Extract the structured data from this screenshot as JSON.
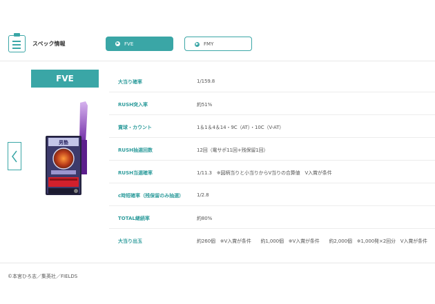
{
  "header": {
    "title": "スペック情報",
    "tabs": [
      {
        "label": "FVE",
        "active": true
      },
      {
        "label": "FMY",
        "active": false
      }
    ]
  },
  "model": {
    "name": "FVE"
  },
  "specs": [
    {
      "label": "大当り確率",
      "value": "1/159.8"
    },
    {
      "label": "RUSH突入率",
      "value": "約51%"
    },
    {
      "label": "賞球・カウント",
      "value": "1＆1＆4＆14・9C（AT）・10C（V-AT）"
    },
    {
      "label": "RUSH抽選回数",
      "value": "12回（電サポ11回+残保留1回）"
    },
    {
      "label": "RUSH当選確率",
      "value": "1/11.3　※図柄当りと小当りからV当りの合算値　V入賞が条件"
    },
    {
      "label": "c時短確率（残保留のみ抽選）",
      "value": "1/2.8"
    },
    {
      "label": "TOTAL継続率",
      "value": "約80%"
    },
    {
      "label": "大当り出玉",
      "value": "約260個　※V入賞が条件　　約1,000個　※V入賞が条件　　約2,000個　※1,000発×2回分　V入賞が条件"
    }
  ],
  "footer": {
    "copyright": "©本宮ひろ志／集英社／FIELDS"
  },
  "colors": {
    "accent": "#3aa6a6",
    "label": "#2e9c9c"
  },
  "icons": [
    "clipboard-icon",
    "chevron-right-icon",
    "chevron-left-icon"
  ]
}
